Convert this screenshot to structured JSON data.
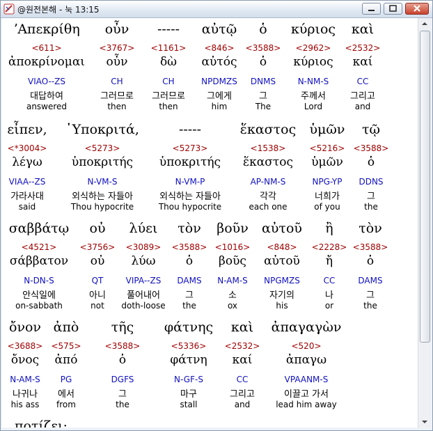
{
  "window": {
    "title": "@원전본해 - 눅 13:15"
  },
  "rows": [
    {
      "words": [
        {
          "greek": "ʼΑπεκρίθη",
          "strong": "<611>",
          "lemma": "ἀποκρίνομαι",
          "parse": "VIAO--ZS",
          "korean": "대답하여",
          "english": "answered"
        },
        {
          "greek": "οὖν",
          "strong": "<3767>",
          "lemma": "οὖν",
          "parse": "CH",
          "korean": "그러므로",
          "english": "then"
        },
        {
          "greek": "-----",
          "strong": "<1161>",
          "lemma": "δὼ",
          "parse": "CH",
          "korean": "그러므로",
          "english": "then"
        },
        {
          "greek": "αὐτῷ",
          "strong": "<846>",
          "lemma": "αὐτός",
          "parse": "NPDMZS",
          "korean": "그에게",
          "english": "him"
        },
        {
          "greek": "ὁ",
          "strong": "<3588>",
          "lemma": "ὁ",
          "parse": "DNMS",
          "korean": "그",
          "english": "The"
        },
        {
          "greek": "κύριος",
          "strong": "<2962>",
          "lemma": "κύριος",
          "parse": "N-NM-S",
          "korean": "주께서",
          "english": "Lord"
        },
        {
          "greek": "καὶ",
          "strong": "<2532>",
          "lemma": "καί",
          "parse": "CC",
          "korean": "그리고",
          "english": "and"
        }
      ]
    },
    {
      "words": [
        {
          "greek": "εἶπεν,",
          "strong": "<*3004>",
          "lemma": "λέγω",
          "parse": "VIAA--ZS",
          "korean": "가라사대",
          "english": "said"
        },
        {
          "greek": "῾Υποκριτά,",
          "strong": "<5273>",
          "lemma": "ὑποκριτής",
          "parse": "N-VM-S",
          "korean": "외식하는 자들아",
          "english": "Thou hypocrite"
        },
        {
          "greek": "-----",
          "strong": "<5273>",
          "lemma": "ὑποκριτής",
          "parse": "N-VM-P",
          "korean": "외식하는 자들아",
          "english": "Thou hypocrite"
        },
        {
          "greek": "ἕκαστος",
          "strong": "<1538>",
          "lemma": "ἕκαστος",
          "parse": "AP-NM-S",
          "korean": "각각",
          "english": "each one"
        },
        {
          "greek": "ὑμῶν",
          "strong": "<5216>",
          "lemma": "ὑμῶν",
          "parse": "NPG-YP",
          "korean": "너희가",
          "english": "of you"
        },
        {
          "greek": "τῷ",
          "strong": "<3588>",
          "lemma": "ὁ",
          "parse": "DDNS",
          "korean": "그",
          "english": "the"
        }
      ]
    },
    {
      "words": [
        {
          "greek": "σαββάτῳ",
          "strong": "<4521>",
          "lemma": "σάββατον",
          "parse": "N-DN-S",
          "korean": "안식일에",
          "english": "on-sabbath"
        },
        {
          "greek": "οὐ",
          "strong": "<3756>",
          "lemma": "οὐ",
          "parse": "QT",
          "korean": "아니",
          "english": "not"
        },
        {
          "greek": "λύει",
          "strong": "<3089>",
          "lemma": "λύω",
          "parse": "VIPA--ZS",
          "korean": "풀어내어",
          "english": "doth-loose"
        },
        {
          "greek": "τὸν",
          "strong": "<3588>",
          "lemma": "ὁ",
          "parse": "DAMS",
          "korean": "그",
          "english": "the"
        },
        {
          "greek": "βοῦν",
          "strong": "<1016>",
          "lemma": "βοῦς",
          "parse": "N-AM-S",
          "korean": "소",
          "english": "ox"
        },
        {
          "greek": "αὐτοῦ",
          "strong": "<848>",
          "lemma": "αὐτοῦ",
          "parse": "NPGMZS",
          "korean": "자기의",
          "english": "his"
        },
        {
          "greek": "ἢ",
          "strong": "<2228>",
          "lemma": "ἤ",
          "parse": "CC",
          "korean": "나",
          "english": "or"
        },
        {
          "greek": "τὸν",
          "strong": "<3588>",
          "lemma": "ὁ",
          "parse": "DAMS",
          "korean": "그",
          "english": "the"
        }
      ]
    },
    {
      "words": [
        {
          "greek": "ὄνον",
          "strong": "<3688>",
          "lemma": "ὄνος",
          "parse": "N-AM-S",
          "korean": "나귀나",
          "english": "his ass"
        },
        {
          "greek": "ἀπὸ",
          "strong": "<575>",
          "lemma": "ἀπό",
          "parse": "PG",
          "korean": "에서",
          "english": "from"
        },
        {
          "greek": "τῆς",
          "strong": "<3588>",
          "lemma": "ὁ",
          "parse": "DGFS",
          "korean": "그",
          "english": "the"
        },
        {
          "greek": "φάτνης",
          "strong": "<5336>",
          "lemma": "φάτνη",
          "parse": "N-GF-S",
          "korean": "마구",
          "english": "stall"
        },
        {
          "greek": "καὶ",
          "strong": "<2532>",
          "lemma": "καί",
          "parse": "CC",
          "korean": "그리고",
          "english": "and"
        },
        {
          "greek": "ἀπαγαγὼν",
          "strong": "<520>",
          "lemma": "ἀπαγω",
          "parse": "VPAANM-S",
          "korean": "이끌고 가서",
          "english": "lead him away"
        }
      ]
    },
    {
      "words": [
        {
          "greek": "ποτίζει;"
        }
      ]
    }
  ]
}
